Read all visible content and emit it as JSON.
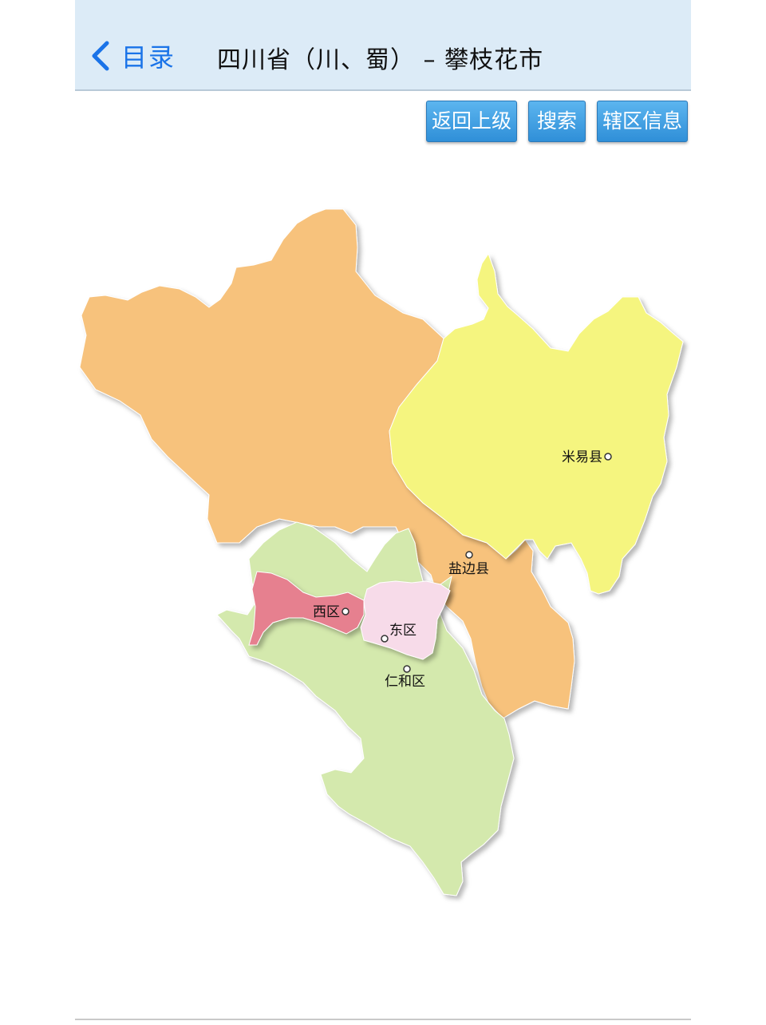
{
  "navbar": {
    "back_label": "目录",
    "title": "四川省（川、蜀） – 攀枝花市"
  },
  "toolbar": {
    "up_label": "返回上级",
    "search_label": "搜索",
    "info_label": "辖区信息"
  },
  "map": {
    "regions": [
      {
        "name": "米易县",
        "color": "#f5f57f"
      },
      {
        "name": "盐边县",
        "color": "#f7c27c"
      },
      {
        "name": "西区",
        "color": "#e6808f"
      },
      {
        "name": "东区",
        "color": "#f7dbe9"
      },
      {
        "name": "仁和区",
        "color": "#d4e9ad"
      }
    ]
  }
}
